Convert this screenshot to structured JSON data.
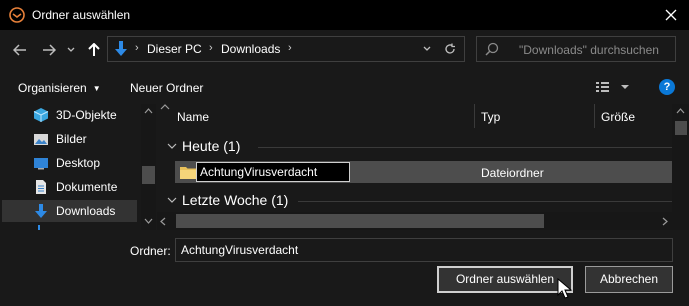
{
  "window": {
    "title": "Ordner auswählen"
  },
  "navigation": {
    "breadcrumb": [
      "Dieser PC",
      "Downloads"
    ],
    "search_placeholder": "\"Downloads\" durchsuchen"
  },
  "toolbar": {
    "organize_label": "Organisieren",
    "new_folder_label": "Neuer Ordner",
    "help_label": "?"
  },
  "sidebar": {
    "items": [
      {
        "label": "3D-Objekte",
        "icon": "cube-3d-icon"
      },
      {
        "label": "Bilder",
        "icon": "pictures-icon"
      },
      {
        "label": "Desktop",
        "icon": "desktop-icon"
      },
      {
        "label": "Dokumente",
        "icon": "documents-icon"
      },
      {
        "label": "Downloads",
        "icon": "download-arrow-icon",
        "selected": true
      }
    ]
  },
  "file_list": {
    "columns": [
      "Name",
      "Typ",
      "Größe"
    ],
    "groups": [
      {
        "label": "Heute (1)",
        "rows": [
          {
            "name": "AchtungVirusverdacht",
            "type": "Dateiordner",
            "size": "",
            "editing": true
          }
        ]
      },
      {
        "label": "Letzte Woche (1)",
        "rows": []
      }
    ]
  },
  "footer": {
    "folder_label": "Ordner:",
    "folder_value": "AchtungVirusverdacht",
    "select_button": "Ordner auswählen",
    "cancel_button": "Abbrechen"
  },
  "colors": {
    "background": "#191919",
    "titlebar": "#000000",
    "selection": "#4d4d4d",
    "accent": "#0a78d7",
    "folder": "#e8c05a"
  }
}
